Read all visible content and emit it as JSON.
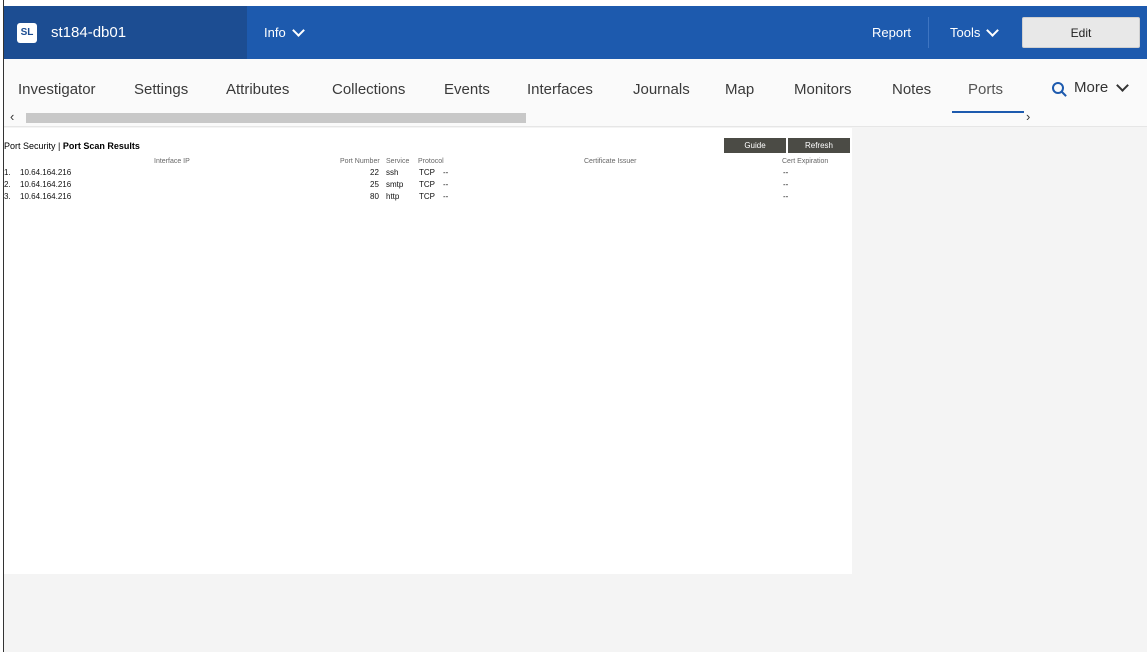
{
  "header": {
    "device_name": "st184-db01",
    "info_label": "Info",
    "report_label": "Report",
    "tools_label": "Tools",
    "edit_label": "Edit"
  },
  "tabs": [
    "Investigator",
    "Settings",
    "Attributes",
    "Collections",
    "Events",
    "Interfaces",
    "Journals",
    "Map",
    "Monitors",
    "Notes",
    "Ports"
  ],
  "active_tab": "Ports",
  "more_label": "More",
  "scroll": {
    "left": "‹",
    "right": "›"
  },
  "panel": {
    "breadcrumb_parent": "Port Security",
    "breadcrumb_sep": " | ",
    "breadcrumb_current": "Port Scan Results",
    "guide_label": "Guide",
    "refresh_label": "Refresh",
    "columns": {
      "interface_ip": "Interface IP",
      "port_number": "Port Number",
      "service": "Service",
      "protocol": "Protocol",
      "certificate_issuer": "Certificate Issuer",
      "cert_expiration": "Cert Expiration"
    },
    "rows": [
      {
        "index": "1.",
        "ip": "10.64.164.216",
        "port": "22",
        "service": "ssh",
        "protocol": "TCP",
        "issuer": "--",
        "expiration": "--"
      },
      {
        "index": "2.",
        "ip": "10.64.164.216",
        "port": "25",
        "service": "smtp",
        "protocol": "TCP",
        "issuer": "--",
        "expiration": "--"
      },
      {
        "index": "3.",
        "ip": "10.64.164.216",
        "port": "80",
        "service": "http",
        "protocol": "TCP",
        "issuer": "--",
        "expiration": "--"
      }
    ]
  },
  "colors": {
    "topbar": "#1d5aae",
    "device_bg": "#1c4d92",
    "tab_active_underline": "#1d5aae",
    "button_dark": "#4b4b45"
  }
}
